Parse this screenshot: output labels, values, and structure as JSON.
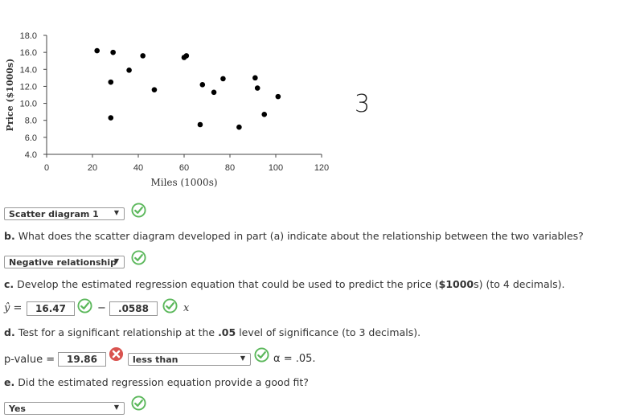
{
  "chart_data": {
    "type": "scatter",
    "ylabel": "Price ($1000s)",
    "xlabel": "Miles (1000s)",
    "xlim": [
      0,
      120
    ],
    "ylim": [
      4.0,
      18.0
    ],
    "x_ticks": [
      "0",
      "20",
      "40",
      "60",
      "80",
      "100",
      "120"
    ],
    "y_ticks": [
      "4.0",
      "6.0",
      "8.0",
      "10.0",
      "12.0",
      "14.0",
      "16.0",
      "18.0"
    ],
    "points": [
      {
        "x": 22,
        "y": 16.2
      },
      {
        "x": 29,
        "y": 16.0
      },
      {
        "x": 36,
        "y": 13.9
      },
      {
        "x": 42,
        "y": 15.6
      },
      {
        "x": 28,
        "y": 12.5
      },
      {
        "x": 47,
        "y": 11.6
      },
      {
        "x": 28,
        "y": 8.3
      },
      {
        "x": 60,
        "y": 15.4
      },
      {
        "x": 61,
        "y": 15.6
      },
      {
        "x": 68,
        "y": 12.2
      },
      {
        "x": 73,
        "y": 11.3
      },
      {
        "x": 77,
        "y": 12.9
      },
      {
        "x": 67,
        "y": 7.5
      },
      {
        "x": 84,
        "y": 7.2
      },
      {
        "x": 91,
        "y": 13.0
      },
      {
        "x": 92,
        "y": 11.8
      },
      {
        "x": 95,
        "y": 8.7
      },
      {
        "x": 101,
        "y": 10.8
      }
    ]
  },
  "panel_number": "3",
  "part_a": {
    "dropdown": "Scatter diagram 1"
  },
  "part_b": {
    "prefix": "b.",
    "question": "What does the scatter diagram developed in part (a) indicate about the relationship between the two variables?",
    "dropdown": "Negative relationship"
  },
  "part_c": {
    "prefix": "c.",
    "question_start": "Develop the estimated regression equation that could be used to predict the price (",
    "question_unit": "$1000",
    "question_end": "s) (to 4 decimals).",
    "yhat": "ŷ",
    "equals": "=",
    "intercept": "16.47",
    "minus": "−",
    "slope": ".0588",
    "xvar": "x"
  },
  "part_d": {
    "prefix": "d.",
    "question_start": "Test for a significant relationship at the ",
    "question_level": ".05",
    "question_end": " level of significance (to 3 decimals).",
    "pvalue_label": "p-value =",
    "pvalue": "19.86",
    "comparison": "less than",
    "alpha_text": "α = .05."
  },
  "part_e": {
    "prefix": "e.",
    "question": "Did the estimated regression equation provide a good fit?",
    "dropdown": "Yes"
  },
  "colors": {
    "correct": "#5cb85c",
    "incorrect": "#d9534f",
    "points": "#000000"
  },
  "icons": {
    "correct": "check-circle-icon",
    "incorrect": "x-circle-icon",
    "dropdown": "triangle-down-icon"
  }
}
